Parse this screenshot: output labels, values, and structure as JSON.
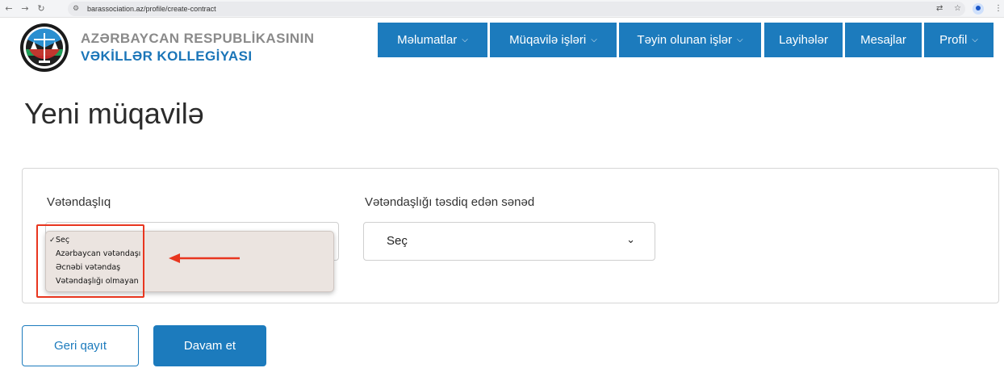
{
  "browser": {
    "back_icon": "arrow-left-icon",
    "forward_icon": "arrow-right-icon",
    "reload_icon": "reload-icon",
    "url": "barassociation.az/profile/create-contract"
  },
  "header": {
    "org_line1": "AZƏRBAYCAN RESPUBLİKASININ",
    "org_line2": "VƏKİLLƏR KOLLEGİYASI",
    "nav": [
      {
        "label": "Məlumatlar",
        "has_dropdown": true
      },
      {
        "label": "Müqavilə işləri",
        "has_dropdown": true
      },
      {
        "label": "Təyin olunan işlər",
        "has_dropdown": true
      },
      {
        "label": "Layihələr",
        "has_dropdown": false
      },
      {
        "label": "Mesajlar",
        "has_dropdown": false
      },
      {
        "label": "Profil",
        "has_dropdown": true
      }
    ]
  },
  "page": {
    "title": "Yeni müqavilə"
  },
  "form": {
    "citizenship": {
      "label": "Vətəndaşlıq",
      "options": [
        "Seç",
        "Azərbaycan vətəndaşı",
        "Əcnəbi vətəndaş",
        "Vətəndaşlığı olmayan"
      ],
      "selected": "Seç"
    },
    "document": {
      "label": "Vətəndaşlığı təsdiq edən sənəd",
      "value": "Seç"
    }
  },
  "actions": {
    "back_label": "Geri qayıt",
    "next_label": "Davam et"
  },
  "colors": {
    "brand_blue": "#1c7bbd",
    "annotation_red": "#e8361f"
  }
}
